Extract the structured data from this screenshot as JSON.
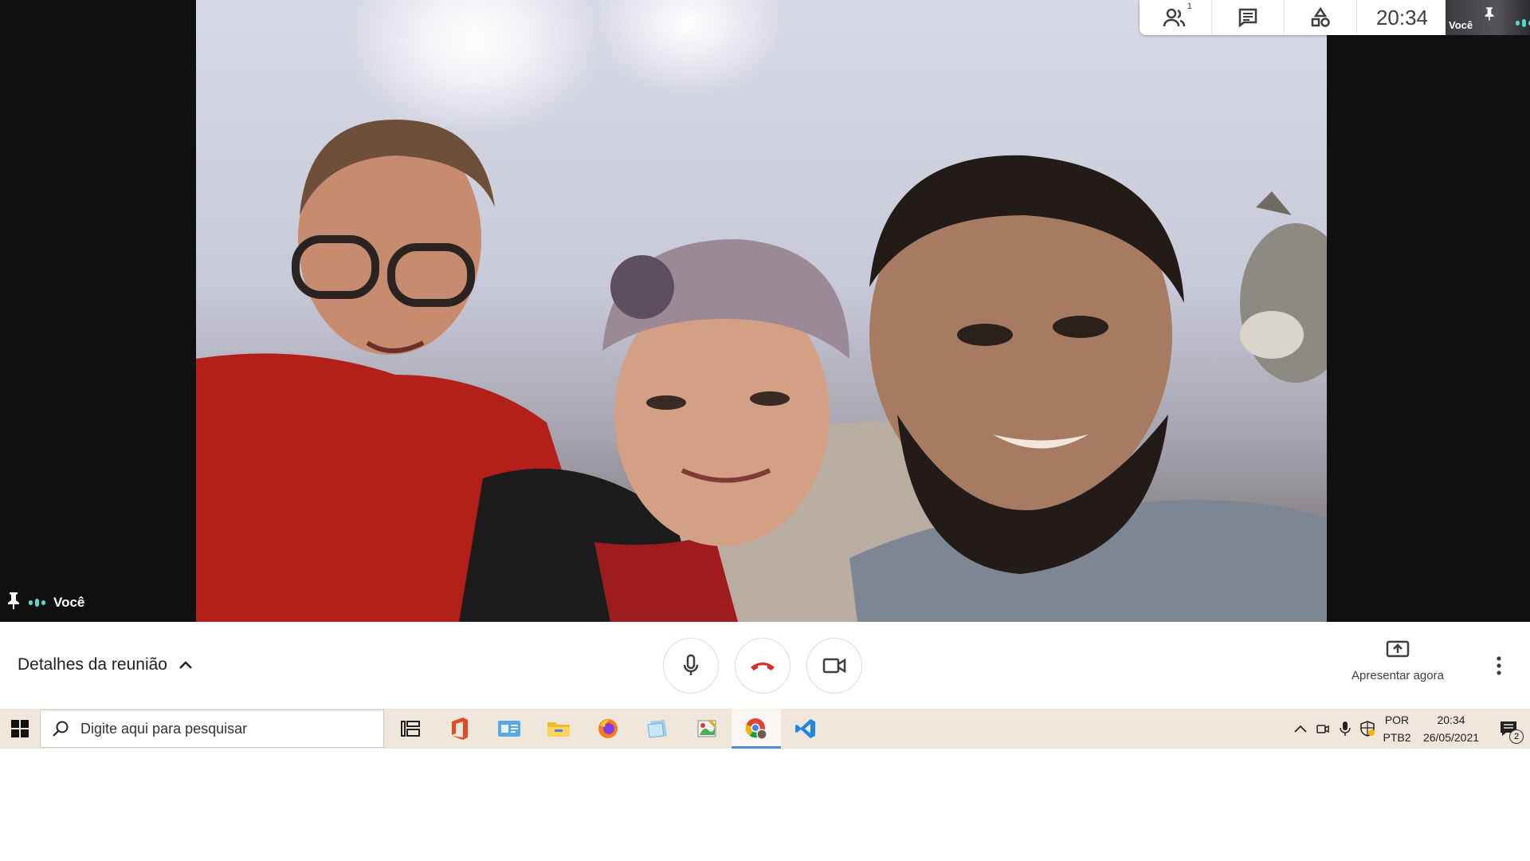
{
  "meet": {
    "top_bar": {
      "people_count": "1",
      "time": "20:34",
      "self_thumbnail_label": "Você",
      "icons": [
        "people-icon",
        "chat-icon",
        "activities-icon"
      ]
    },
    "main_tile": {
      "name": "Você",
      "speaking_color": "#5ad6c8"
    },
    "controls": {
      "meeting_details_label": "Detalhes da reunião",
      "present_label": "Apresentar agora",
      "end_call_color": "#d93025"
    }
  },
  "taskbar": {
    "search_placeholder": "Digite aqui para pesquisar",
    "apps": [
      "task-view",
      "office",
      "mail-card",
      "file-explorer",
      "firefox",
      "notes",
      "paint",
      "chrome",
      "vscode"
    ],
    "active_app": "chrome",
    "tray": {
      "lang_line1": "POR",
      "lang_line2": "PTB2",
      "time": "20:34",
      "date": "26/05/2021",
      "notification_count": "2"
    }
  }
}
